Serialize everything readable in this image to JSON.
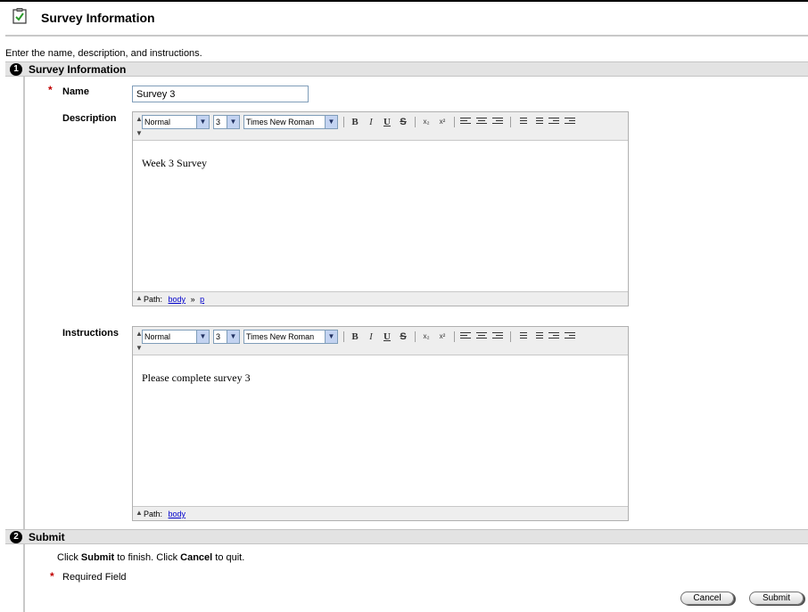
{
  "header": {
    "title": "Survey Information",
    "icon": "clipboard-check-icon"
  },
  "intro_text": "Enter the name, description, and instructions.",
  "section1": {
    "number": "1",
    "title": "Survey Information"
  },
  "fields": {
    "required_mark": "*",
    "name": {
      "label": "Name",
      "value": "Survey 3"
    },
    "description": {
      "label": "Description",
      "content": "Week 3 Survey"
    },
    "instructions": {
      "label": "Instructions",
      "content": "Please complete survey 3"
    }
  },
  "editor_toolbar": {
    "style": "Normal",
    "size": "3",
    "font": "Times New Roman",
    "bold": "B",
    "italic": "I",
    "underline": "U",
    "strike": "S",
    "subscript": "x₂",
    "superscript": "x²"
  },
  "editor_status": {
    "path_label": "Path:",
    "description_path": [
      "body",
      "p"
    ],
    "instructions_path": [
      "body"
    ],
    "separator": "»"
  },
  "section2": {
    "number": "2",
    "title": "Submit"
  },
  "submit_help": {
    "prefix": "Click ",
    "submit": "Submit",
    "middle": " to finish. Click ",
    "cancel": "Cancel",
    "suffix": " to quit."
  },
  "required_legend": "Required Field",
  "buttons": {
    "cancel": "Cancel",
    "submit": "Submit"
  },
  "colors": {
    "required": "#c00000",
    "link": "#0000cc",
    "section_bar": "#e3e3e3"
  }
}
